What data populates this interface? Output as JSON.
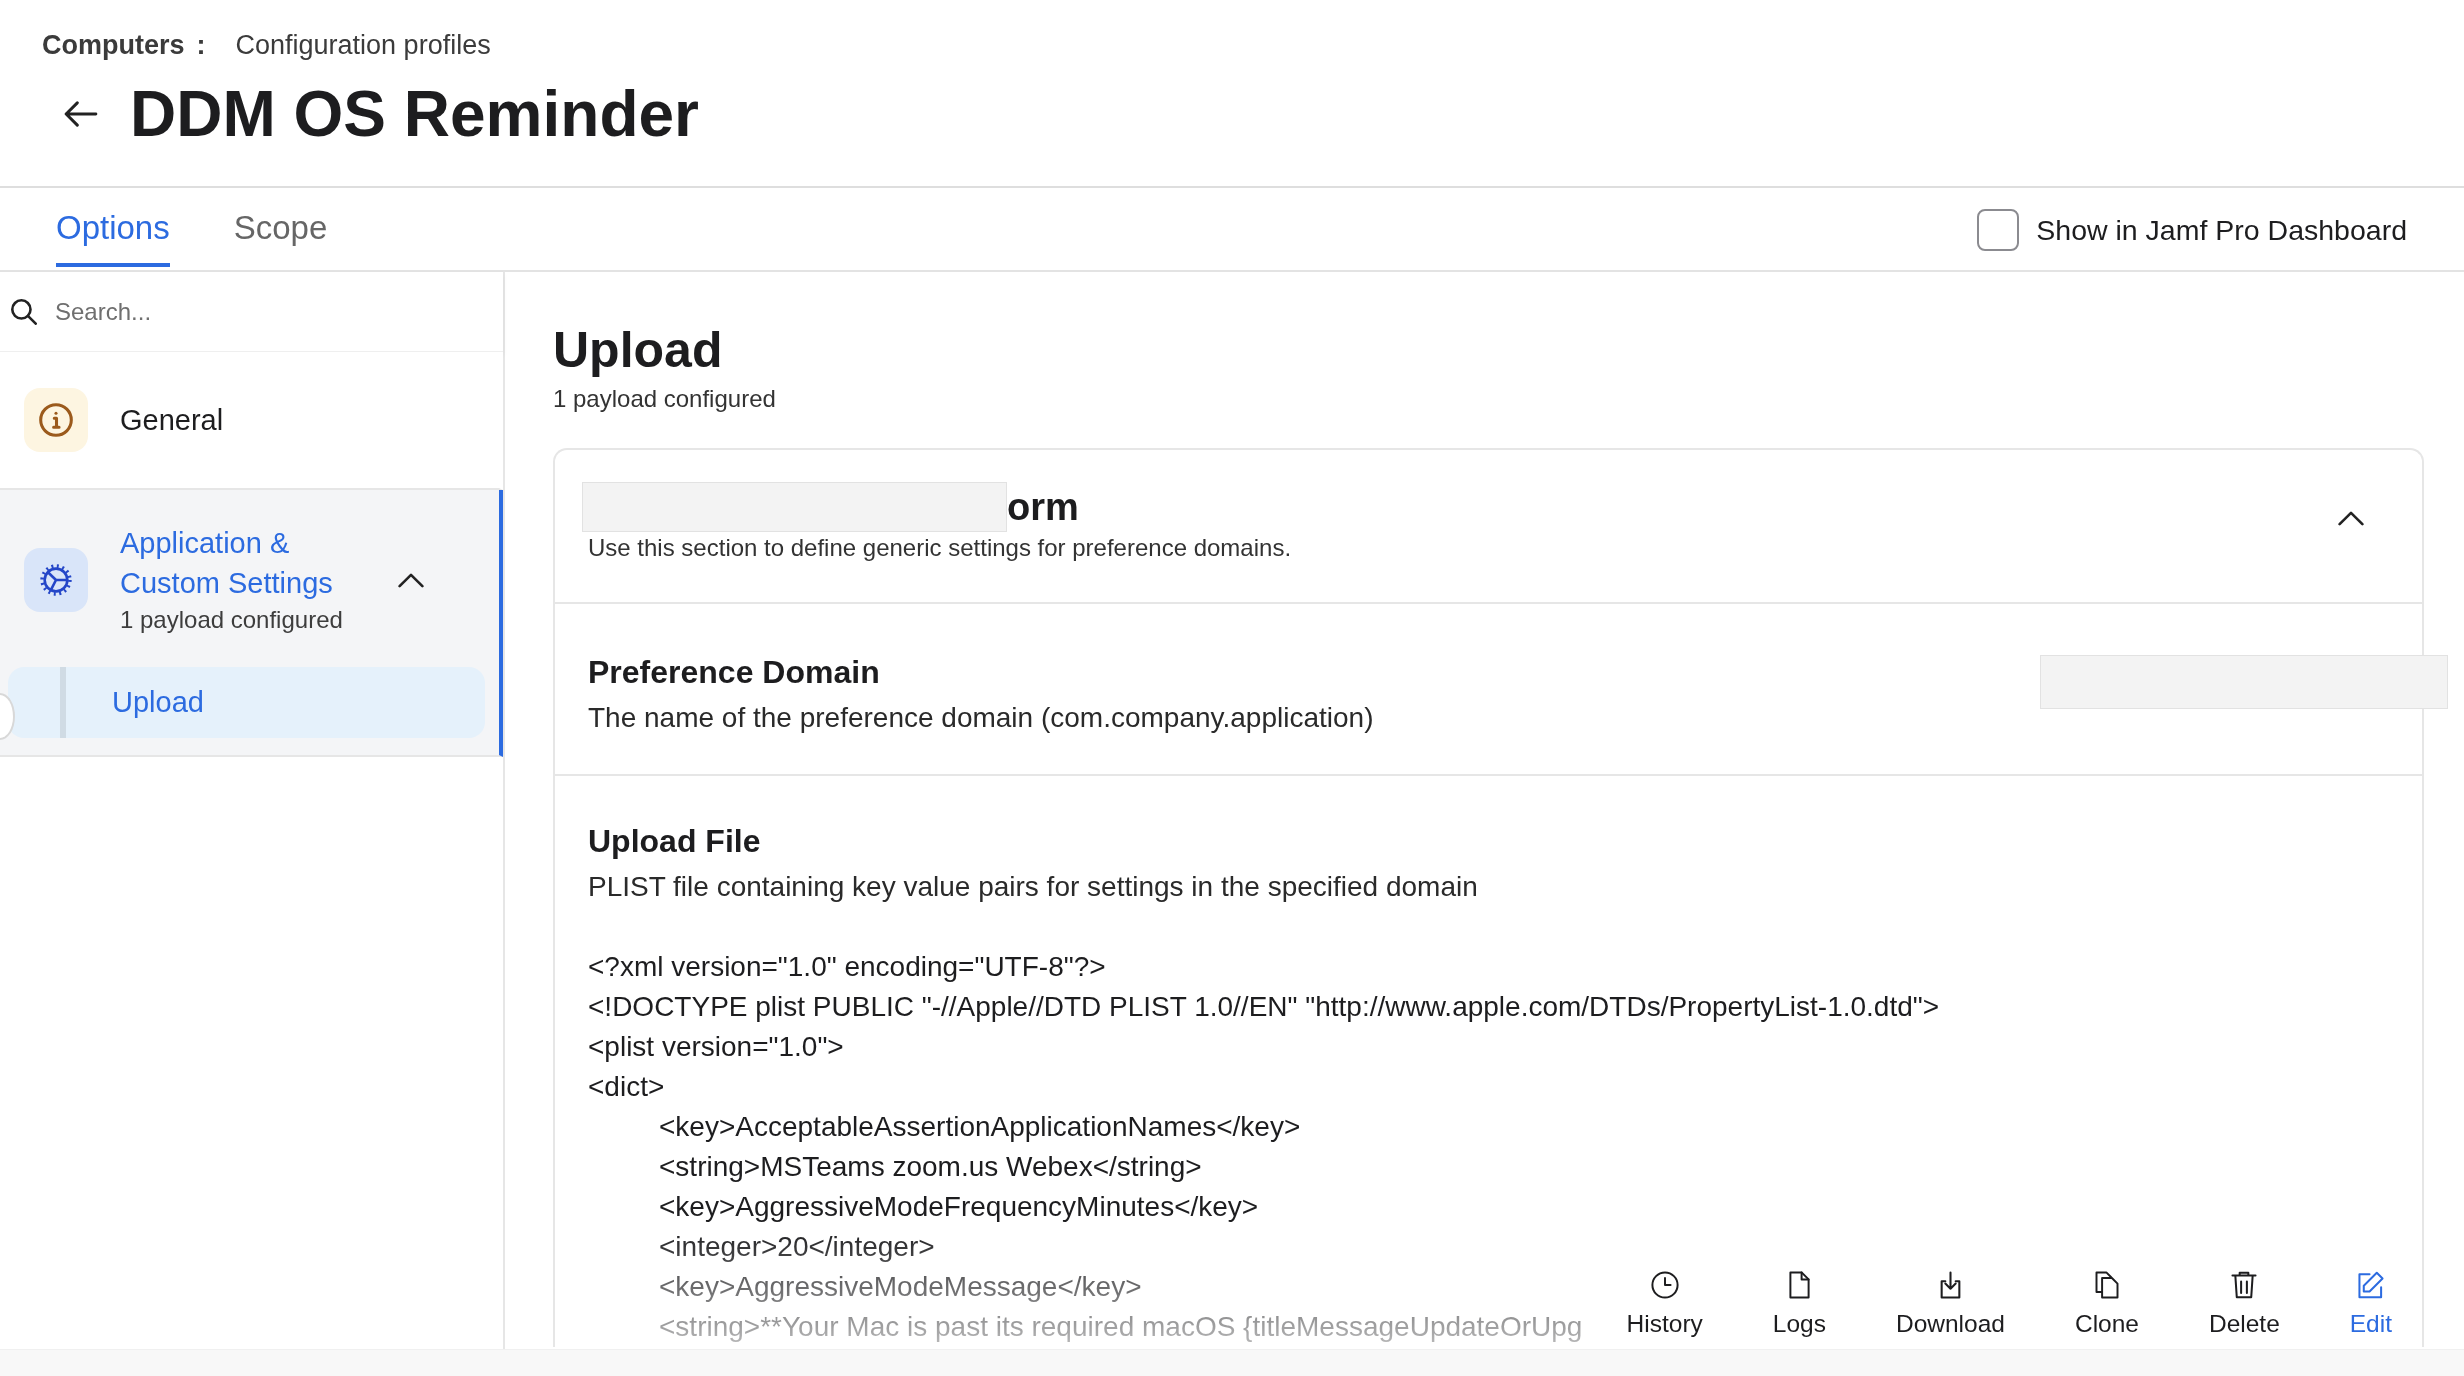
{
  "breadcrumb": {
    "parent": "Computers",
    "separator": ":",
    "current": "Configuration profiles"
  },
  "title": "DDM OS Reminder",
  "tabs": [
    {
      "label": "Options",
      "selected": true
    },
    {
      "label": "Scope",
      "selected": false
    }
  ],
  "dashboard_option": {
    "label": "Show in Jamf Pro Dashboard",
    "checked": false
  },
  "sidebar": {
    "search": {
      "placeholder": "Search..."
    },
    "items": [
      {
        "kind": "info",
        "label": "General",
        "selected": false
      },
      {
        "kind": "gear",
        "label": "Application & Custom Settings",
        "subtitle": "1 payload configured",
        "selected": true,
        "expanded": true,
        "children": [
          {
            "label": "Upload",
            "selected": true
          }
        ]
      }
    ]
  },
  "payload": {
    "title": "Upload",
    "subtitle": "1 payload configured"
  },
  "card": {
    "title": "orm",
    "description": "Use this section to define generic settings for preference domains.",
    "expanded": true,
    "fields": [
      {
        "kind": "text",
        "label": "Preference Domain",
        "description": "The name of the preference domain (com.company.application)"
      },
      {
        "kind": "file",
        "label": "Upload File",
        "description": "PLIST file containing key value pairs for settings in the specified domain",
        "content": [
          {
            "text": "<?xml version=\"1.0\" encoding=\"UTF-8\"?>"
          },
          {
            "text": "<!DOCTYPE plist PUBLIC \"-//Apple//DTD PLIST 1.0//EN\" \"http://www.apple.com/DTDs/PropertyList-1.0.dtd\">"
          },
          {
            "text": "<plist version=\"1.0\">"
          },
          {
            "text": "<dict>",
            "children": [
              {
                "text": "<key>AcceptableAssertionApplicationNames</key>"
              },
              {
                "text": "<string>MSTeams zoom.us Webex</string>"
              },
              {
                "text": "<key>AggressiveModeFrequencyMinutes</key>"
              },
              {
                "text": "<integer>20</integer>"
              },
              {
                "text": "<key>AggressiveModeMessage</key>"
              },
              {
                "text": "<string>**Your Mac is past its required macOS {titleMessageUpdateOrUpg"
              }
            ]
          }
        ]
      }
    ]
  },
  "toolbar": [
    {
      "kind": "history",
      "label": "History",
      "primary": false
    },
    {
      "kind": "logs",
      "label": "Logs",
      "primary": false
    },
    {
      "kind": "download",
      "label": "Download",
      "primary": false
    },
    {
      "kind": "clone",
      "label": "Clone",
      "primary": false
    },
    {
      "kind": "delete",
      "label": "Delete",
      "primary": false
    },
    {
      "kind": "edit",
      "label": "Edit",
      "primary": true
    }
  ]
}
